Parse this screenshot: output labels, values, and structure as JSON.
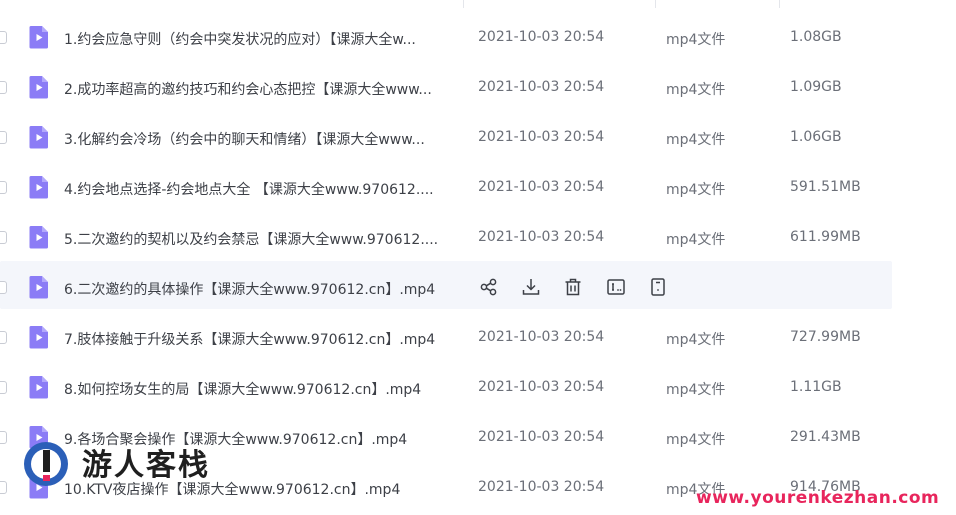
{
  "files": [
    {
      "name": "1.约会应急守则（约会中突发状况的应对）【课源大全w...",
      "date": "2021-10-03 20:54",
      "type": "mp4文件",
      "size": "1.08GB"
    },
    {
      "name": "2.成功率超高的邀约技巧和约会心态把控【课源大全www...",
      "date": "2021-10-03 20:54",
      "type": "mp4文件",
      "size": "1.09GB"
    },
    {
      "name": "3.化解约会冷场（约会中的聊天和情绪）【课源大全www...",
      "date": "2021-10-03 20:54",
      "type": "mp4文件",
      "size": "1.06GB"
    },
    {
      "name": "4.约会地点选择-约会地点大全 【课源大全www.970612....",
      "date": "2021-10-03 20:54",
      "type": "mp4文件",
      "size": "591.51MB"
    },
    {
      "name": "5.二次邀约的契机以及约会禁忌【课源大全www.970612....",
      "date": "2021-10-03 20:54",
      "type": "mp4文件",
      "size": "611.99MB"
    },
    {
      "name": "6.二次邀约的具体操作【课源大全www.970612.cn】.mp4",
      "date": "",
      "type": "",
      "size": "",
      "hover": true
    },
    {
      "name": "7.肢体接触于升级关系【课源大全www.970612.cn】.mp4",
      "date": "2021-10-03 20:54",
      "type": "mp4文件",
      "size": "727.99MB"
    },
    {
      "name": "8.如何控场女生的局【课源大全www.970612.cn】.mp4",
      "date": "2021-10-03 20:54",
      "type": "mp4文件",
      "size": "1.11GB"
    },
    {
      "name": "9.各场合聚会操作【课源大全www.970612.cn】.mp4",
      "date": "2021-10-03 20:54",
      "type": "mp4文件",
      "size": "291.43MB"
    },
    {
      "name": "10.KTV夜店操作【课源大全www.970612.cn】.mp4",
      "date": "2021-10-03 20:54",
      "type": "mp4文件",
      "size": "914.76MB"
    }
  ],
  "hover_actions": [
    "share-icon",
    "download-icon",
    "delete-icon",
    "rename-icon",
    "more-icon"
  ],
  "watermark": {
    "title": "游人客栈",
    "url": "www.yourenkezhan.com"
  },
  "colors": {
    "file_icon": "#8b7cf6",
    "hover_row": "#f4f6fb",
    "watermark_url": "#e8255c"
  }
}
